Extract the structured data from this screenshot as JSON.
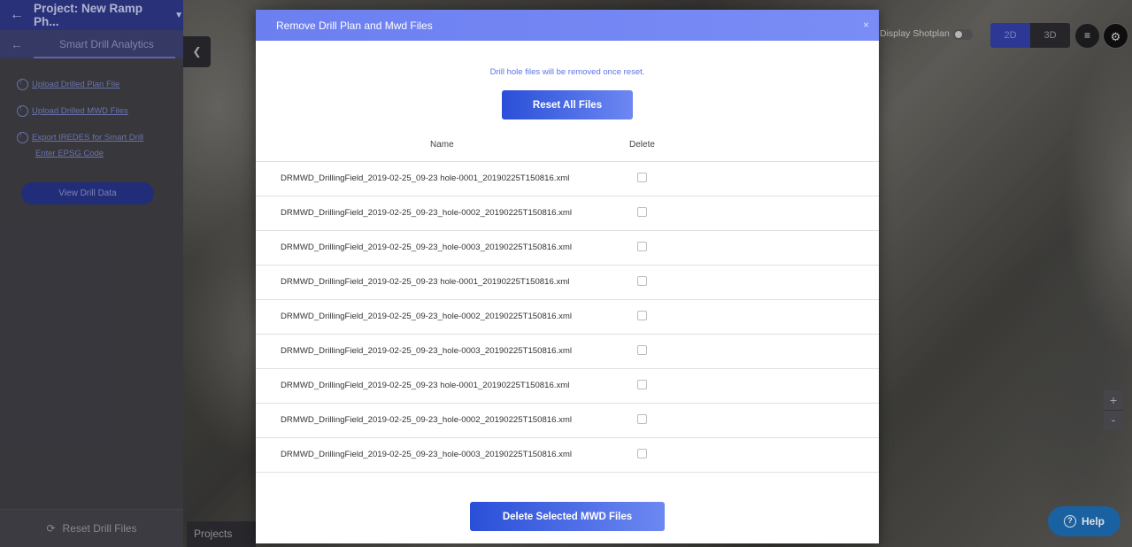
{
  "sidebar": {
    "project_title": "Project: New Ramp Ph...",
    "section_title": "Smart Drill Analytics",
    "links": [
      {
        "label": "Upload Drilled Plan File"
      },
      {
        "label": "Upload Drilled MWD Files"
      },
      {
        "label": "Export IREDES for Smart Drill"
      }
    ],
    "epsg_label": "Enter EPSG Code",
    "view_button": "View Drill Data",
    "reset_label": "Reset Drill Files"
  },
  "map": {
    "projects_tab": "Projects",
    "shotplan_label": "Display Shotplan",
    "shotplan_on": false,
    "view_modes": [
      "2D",
      "3D"
    ],
    "active_view": "2D",
    "zoom_in": "+",
    "zoom_out": "-",
    "help_label": "Help"
  },
  "modal": {
    "title": "Remove Drill Plan and Mwd Files",
    "close": "×",
    "info_text": "Drill hole files will be removed once reset.",
    "reset_all_button": "Reset All Files",
    "columns": {
      "name": "Name",
      "delete": "Delete"
    },
    "files": [
      {
        "name": "DRMWD_DrillingField_2019-02-25_09-23 hole-0001_20190225T150816.xml",
        "checked": false
      },
      {
        "name": "DRMWD_DrillingField_2019-02-25_09-23_hole-0002_20190225T150816.xml",
        "checked": false
      },
      {
        "name": "DRMWD_DrillingField_2019-02-25_09-23_hole-0003_20190225T150816.xml",
        "checked": false
      },
      {
        "name": "DRMWD_DrillingField_2019-02-25_09-23 hole-0001_20190225T150816.xml",
        "checked": false
      },
      {
        "name": "DRMWD_DrillingField_2019-02-25_09-23_hole-0002_20190225T150816.xml",
        "checked": false
      },
      {
        "name": "DRMWD_DrillingField_2019-02-25_09-23_hole-0003_20190225T150816.xml",
        "checked": false
      },
      {
        "name": "DRMWD_DrillingField_2019-02-25_09-23 hole-0001_20190225T150816.xml",
        "checked": false
      },
      {
        "name": "DRMWD_DrillingField_2019-02-25_09-23_hole-0002_20190225T150816.xml",
        "checked": false
      },
      {
        "name": "DRMWD_DrillingField_2019-02-25_09-23_hole-0003_20190225T150816.xml",
        "checked": false
      }
    ],
    "delete_selected_button": "Delete Selected MWD Files"
  },
  "colors": {
    "accent": "#6c7ff0",
    "button_start": "#2a4fd8",
    "button_end": "#6d88f2",
    "help": "#1e6fb8"
  }
}
